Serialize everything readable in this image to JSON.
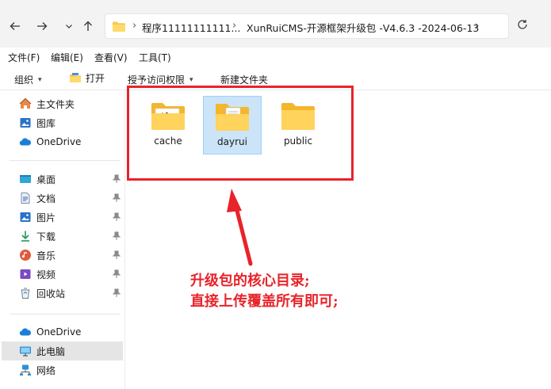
{
  "breadcrumb": {
    "path_1": "程序11111111111...",
    "path_2": "XunRuiCMS-开源框架升级包 -V4.6.3 -2024-06-13"
  },
  "menu": {
    "items": [
      "文件(F)",
      "编辑(E)",
      "查看(V)",
      "工具(T)"
    ]
  },
  "toolbar": {
    "organize": "组织",
    "open": "打开",
    "grant_access": "授予访问权限",
    "new_folder": "新建文件夹"
  },
  "nav": {
    "home": "主文件夹",
    "gallery": "图库",
    "onedrive_top": "OneDrive",
    "desktop": "桌面",
    "documents": "文档",
    "pictures": "图片",
    "downloads": "下载",
    "music": "音乐",
    "videos": "视频",
    "recycle": "回收站",
    "onedrive": "OneDrive",
    "this_pc": "此电脑",
    "network": "网络"
  },
  "files": [
    {
      "name": "cache"
    },
    {
      "name": "dayrui"
    },
    {
      "name": "public"
    }
  ],
  "annotation": {
    "line1": "升级包的核心目录;",
    "line2": "直接上传覆盖所有即可;"
  },
  "colors": {
    "annotation_red": "#e8232a",
    "folder_yellow": "#f8c94a",
    "selection": "#cce4f7"
  }
}
